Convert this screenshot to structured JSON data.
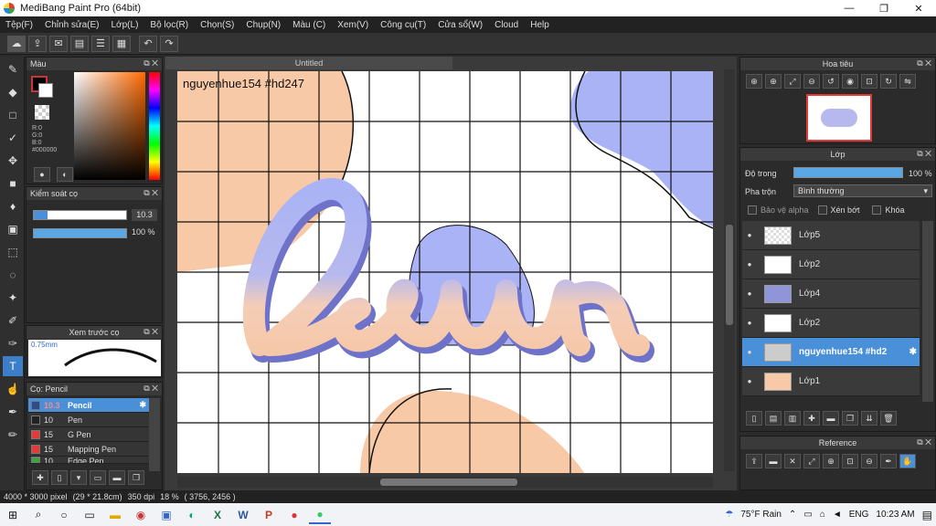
{
  "window": {
    "title": "MediBang Paint Pro (64bit)",
    "minimize": "—",
    "maximize": "❐",
    "close": "✕"
  },
  "menu": [
    "Tệp(F)",
    "Chỉnh sửa(E)",
    "Lớp(L)",
    "Bộ lọc(R)",
    "Chọn(S)",
    "Chụp(N)",
    "Màu (C)",
    "Xem(V)",
    "Công cụ(T)",
    "Cửa sổ(W)",
    "Cloud",
    "Help"
  ],
  "color_panel": {
    "title": "Màu",
    "r": "R:0",
    "g": "G:0",
    "b": "B:0",
    "hex": "#000000"
  },
  "brush_control": {
    "title": "Kiểm soát cọ",
    "size": "10.3",
    "opacity": "100 %",
    "size_fill": 0.15,
    "opacity_fill": 1.0
  },
  "brush_preview": {
    "title": "Xem trước cọ",
    "size_label": "0.75mm"
  },
  "brush_list": {
    "title": "Cọ: Pencil",
    "items": [
      {
        "size": "10.3",
        "name": "Pencil",
        "color": "#2d4d8c",
        "selected": true
      },
      {
        "size": "10",
        "name": "Pen",
        "color": "#222222",
        "selected": false
      },
      {
        "size": "15",
        "name": "G Pen",
        "color": "#e53935",
        "selected": false
      },
      {
        "size": "15",
        "name": "Mapping Pen",
        "color": "#e53935",
        "selected": false
      },
      {
        "size": "10",
        "name": "Edge Pen",
        "color": "#43a047",
        "selected": false
      }
    ]
  },
  "canvas": {
    "tab": "Untitled",
    "watermark": "nguyenhue154 #hd247"
  },
  "navigator": {
    "title": "Hoa tiêu"
  },
  "layers_panel": {
    "title": "Lớp",
    "opacity_label": "Độ trong",
    "opacity_value": "100 %",
    "blend_label": "Pha trộn",
    "blend_value": "Bình thường",
    "protect_alpha": "Bảo vệ alpha",
    "clipping": "Xén bớt",
    "lock": "Khóa",
    "layers": [
      {
        "name": "Lớp5",
        "selected": false
      },
      {
        "name": "Lớp2",
        "selected": false
      },
      {
        "name": "Lớp4",
        "selected": false
      },
      {
        "name": "Lớp2",
        "selected": false
      },
      {
        "name": "nguyenhue154 #hd2",
        "selected": true
      },
      {
        "name": "Lớp1",
        "selected": false
      }
    ]
  },
  "reference_panel": {
    "title": "Reference"
  },
  "status": {
    "size": "4000 * 3000 pixel",
    "dims": "(29 * 21.8cm)",
    "dpi": "350 dpi",
    "zoom": "18 %",
    "coords": "( 3756, 2456 )"
  },
  "taskbar": {
    "weather": "75°F Rain",
    "lang": "ENG",
    "time": "10:23 AM"
  }
}
